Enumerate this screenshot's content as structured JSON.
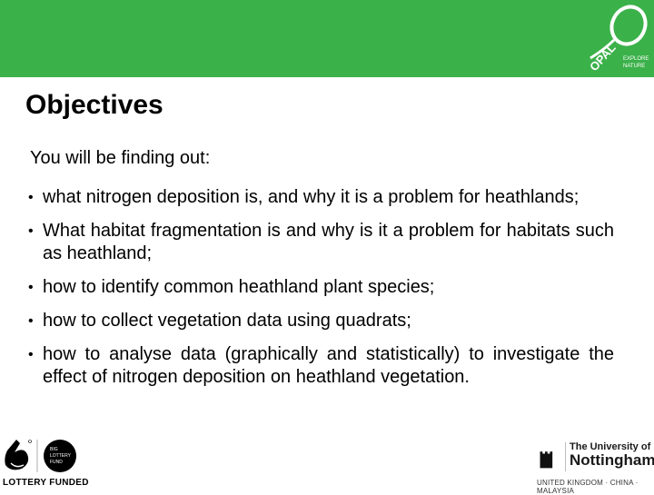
{
  "header": {
    "color": "#3bb14a",
    "logo": {
      "name": "OPAL",
      "tagline_line1": "EXPLORE",
      "tagline_line2": "NATURE",
      "icon": "magnifying-glass-icon"
    }
  },
  "slide": {
    "title": "Objectives",
    "intro": "You will be finding out:",
    "bullets": [
      "what nitrogen deposition is, and why it is a problem for heathlands;",
      "What habitat fragmentation is and why is it a problem for habitats such as heathland;",
      "how to identify common heathland plant species;",
      "how to collect vegetation data using quadrats;",
      "how to analyse data (graphically and statistically) to investigate the effect of nitrogen deposition on heathland vegetation."
    ],
    "bullet_glyph": "•"
  },
  "footer": {
    "lottery": {
      "label": "LOTTERY FUNDED",
      "badge_text_line1": "BIG",
      "badge_text_line2": "LOTTERY",
      "badge_text_line3": "FUND",
      "icon": "crossed-fingers-icon"
    },
    "university": {
      "line1": "The University of",
      "line2": "Nottingham",
      "subline": "UNITED KINGDOM · CHINA · MALAYSIA",
      "icon": "castle-crest-icon"
    }
  }
}
